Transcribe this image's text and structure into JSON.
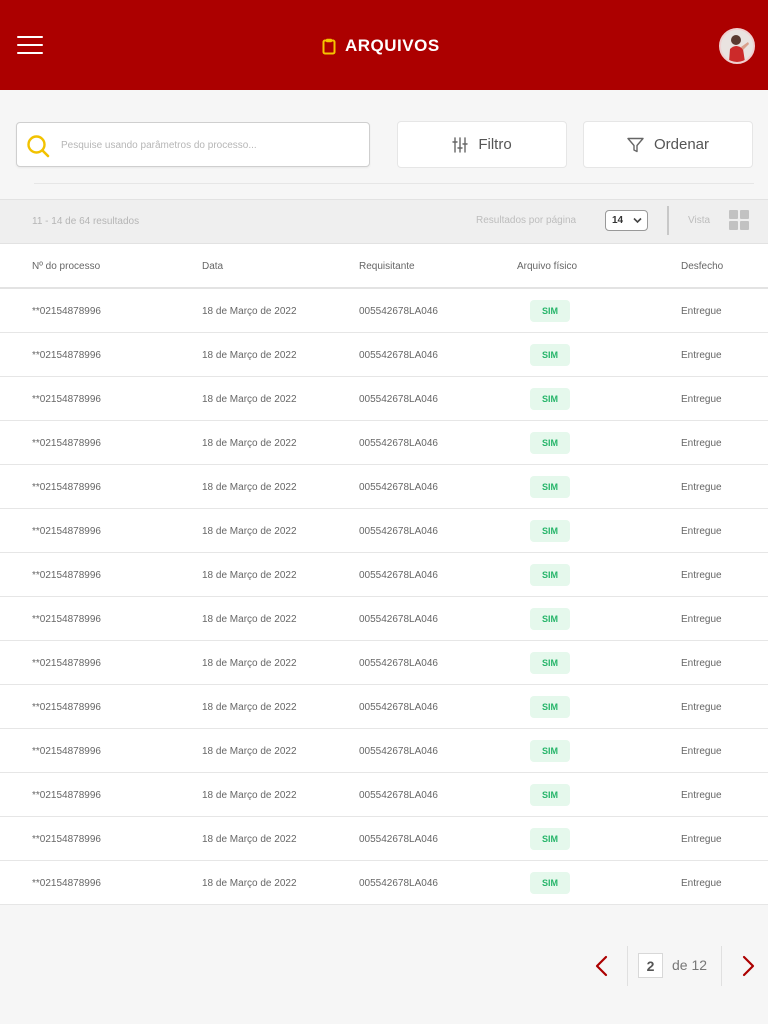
{
  "header": {
    "title": "ARQUIVOS",
    "accent_color": "#ac0000",
    "title_icon": "clipboard-icon"
  },
  "search": {
    "placeholder": "Pesquise usando parâmetros do processo..."
  },
  "toolbar": {
    "filter_label": "Filtro",
    "order_label": "Ordenar"
  },
  "results": {
    "count_text": "11 - 14 de 64 resultados",
    "per_page_label": "Resultados por página",
    "per_page_value": "14",
    "view_label": "Vista"
  },
  "table": {
    "columns": [
      "Nº do processo",
      "Data",
      "Requisitante",
      "Arquivo físico",
      "Desfecho"
    ],
    "rows": [
      {
        "processo": "**02154878996",
        "data": "18 de Março de 2022",
        "requisitante": "005542678LA046",
        "arquivo": "SIM",
        "desfecho": "Entregue"
      },
      {
        "processo": "**02154878996",
        "data": "18 de Março de 2022",
        "requisitante": "005542678LA046",
        "arquivo": "SIM",
        "desfecho": "Entregue"
      },
      {
        "processo": "**02154878996",
        "data": "18 de Março de 2022",
        "requisitante": "005542678LA046",
        "arquivo": "SIM",
        "desfecho": "Entregue"
      },
      {
        "processo": "**02154878996",
        "data": "18 de Março de 2022",
        "requisitante": "005542678LA046",
        "arquivo": "SIM",
        "desfecho": "Entregue"
      },
      {
        "processo": "**02154878996",
        "data": "18 de Março de 2022",
        "requisitante": "005542678LA046",
        "arquivo": "SIM",
        "desfecho": "Entregue"
      },
      {
        "processo": "**02154878996",
        "data": "18 de Março de 2022",
        "requisitante": "005542678LA046",
        "arquivo": "SIM",
        "desfecho": "Entregue"
      },
      {
        "processo": "**02154878996",
        "data": "18 de Março de 2022",
        "requisitante": "005542678LA046",
        "arquivo": "SIM",
        "desfecho": "Entregue"
      },
      {
        "processo": "**02154878996",
        "data": "18 de Março de 2022",
        "requisitante": "005542678LA046",
        "arquivo": "SIM",
        "desfecho": "Entregue"
      },
      {
        "processo": "**02154878996",
        "data": "18 de Março de 2022",
        "requisitante": "005542678LA046",
        "arquivo": "SIM",
        "desfecho": "Entregue"
      },
      {
        "processo": "**02154878996",
        "data": "18 de Março de 2022",
        "requisitante": "005542678LA046",
        "arquivo": "SIM",
        "desfecho": "Entregue"
      },
      {
        "processo": "**02154878996",
        "data": "18 de Março de 2022",
        "requisitante": "005542678LA046",
        "arquivo": "SIM",
        "desfecho": "Entregue"
      },
      {
        "processo": "**02154878996",
        "data": "18 de Março de 2022",
        "requisitante": "005542678LA046",
        "arquivo": "SIM",
        "desfecho": "Entregue"
      },
      {
        "processo": "**02154878996",
        "data": "18 de Março de 2022",
        "requisitante": "005542678LA046",
        "arquivo": "SIM",
        "desfecho": "Entregue"
      },
      {
        "processo": "**02154878996",
        "data": "18 de Março de 2022",
        "requisitante": "005542678LA046",
        "arquivo": "SIM",
        "desfecho": "Entregue"
      }
    ]
  },
  "pagination": {
    "current_page": "2",
    "of_text": "de 12"
  },
  "colors": {
    "header": "#ac0000",
    "badge_bg": "#e5f8ec",
    "badge_text": "#27b56a",
    "search_icon": "#f2c200",
    "pager_arrows": "#ac0000"
  }
}
